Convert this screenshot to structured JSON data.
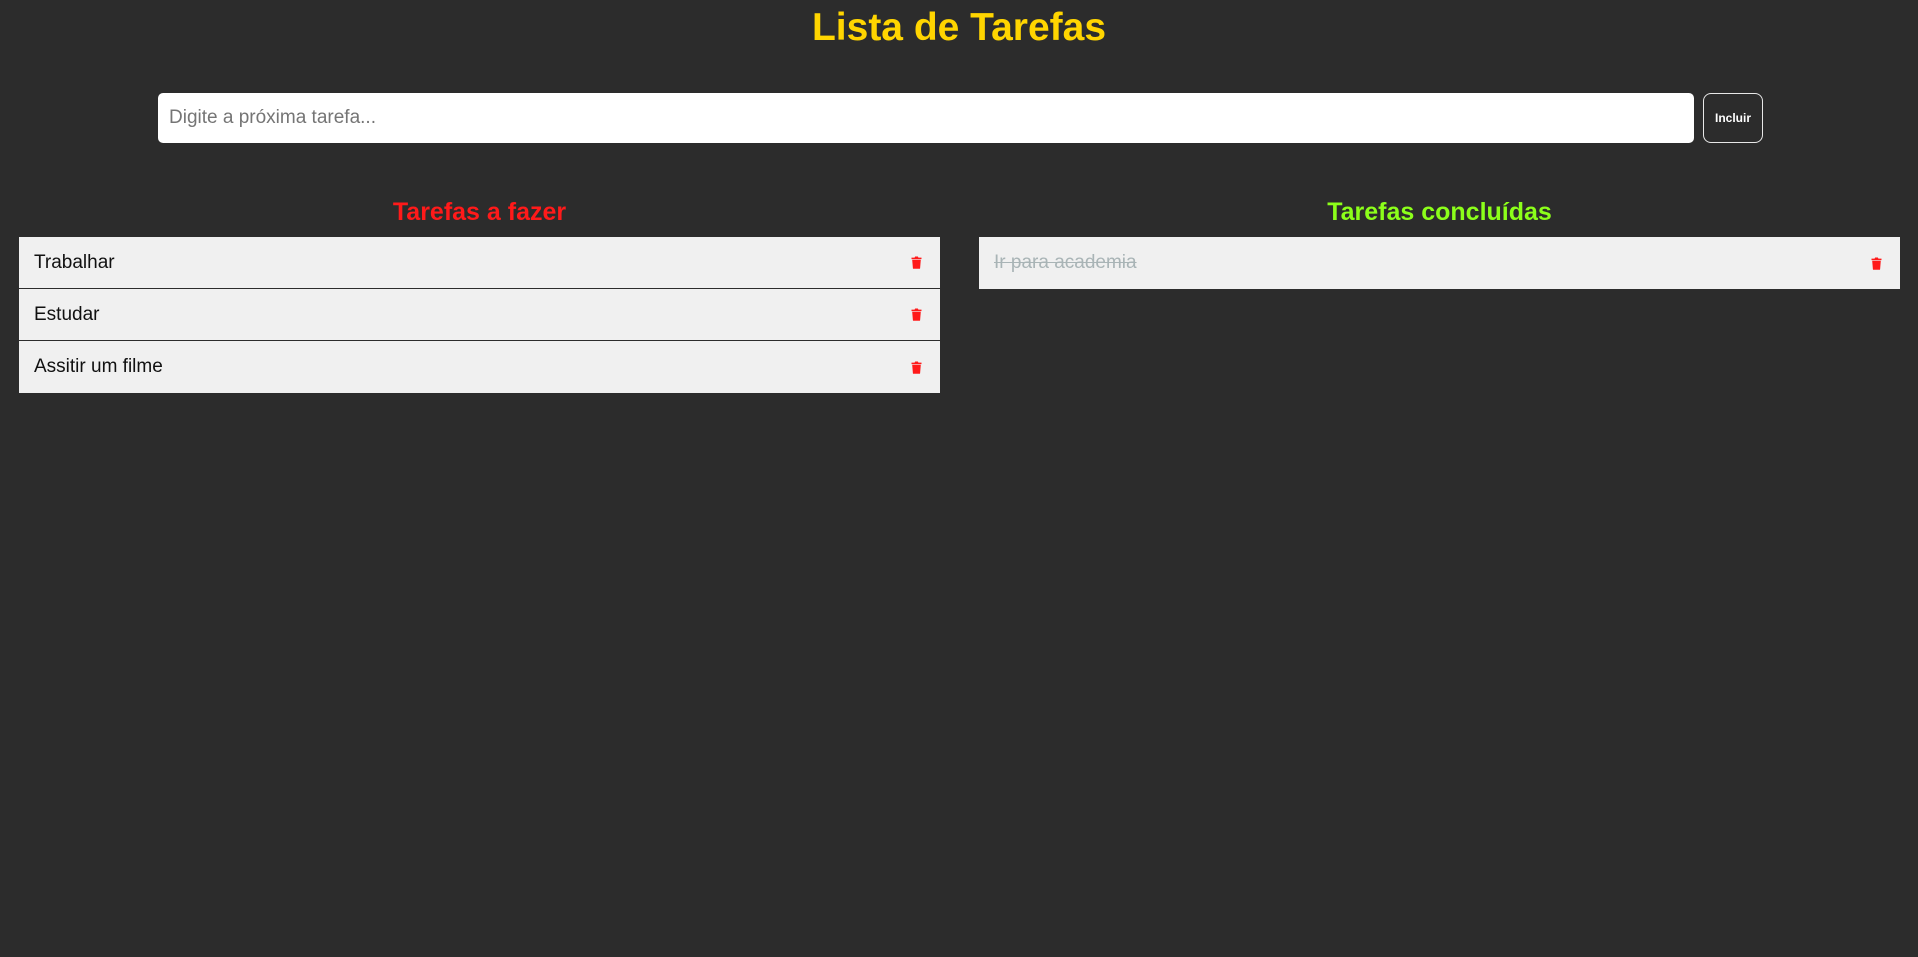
{
  "header": {
    "title": "Lista de Tarefas"
  },
  "new_task": {
    "value": "",
    "placeholder": "Digite a próxima tarefa...",
    "add_label": "Incluir"
  },
  "todo": {
    "title": "Tarefas a fazer",
    "items": [
      {
        "text": "Trabalhar"
      },
      {
        "text": "Estudar"
      },
      {
        "text": "Assitir um filme"
      }
    ]
  },
  "done": {
    "title": "Tarefas concluídas",
    "items": [
      {
        "text": "Ir para academia"
      }
    ]
  },
  "colors": {
    "background": "#2c2c2c",
    "title": "#ffd500",
    "todo_title": "#ff1a1a",
    "done_title": "#8cff1a",
    "delete_icon": "#ff1a1a",
    "item_background": "#f0f0f0",
    "done_text": "#a9b4b6"
  },
  "icons": {
    "delete": "trash-icon"
  }
}
